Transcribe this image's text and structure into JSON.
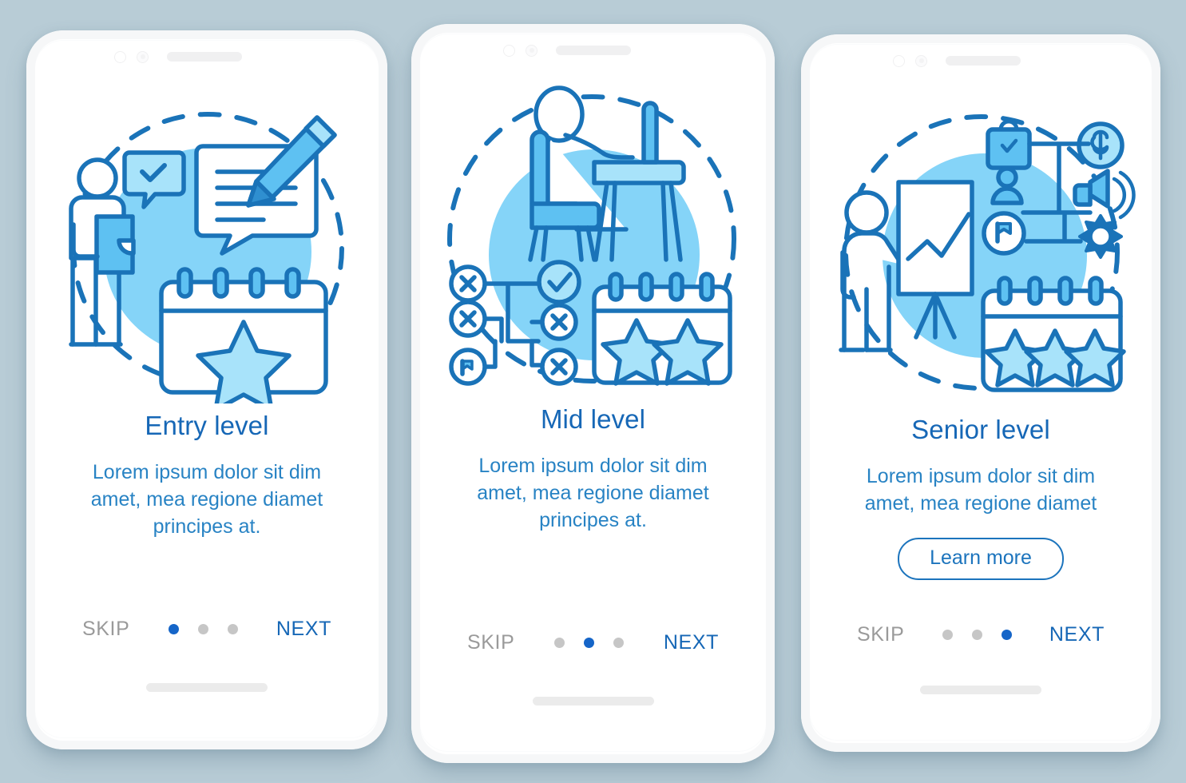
{
  "background_color": "#b8ccd6",
  "theme": {
    "title_color": "#1667b6",
    "body_color": "#2883c4",
    "accent_color": "#1565c8",
    "skip_color": "#9a9a9a",
    "illustration_stroke": "#1a73b8",
    "illustration_fill_light": "#a8e3fa",
    "illustration_fill_mid": "#5ec1f2",
    "illustration_circle": "#85d4f8"
  },
  "screens": [
    {
      "id": "entry-level",
      "title": "Entry level",
      "description": "Lorem ipsum dolor sit dim amet, mea regione diamet principes at.",
      "has_cta": false,
      "cta_label": "",
      "skip_label": "SKIP",
      "next_label": "NEXT",
      "dots": 3,
      "active_dot": 0,
      "illustration_name": "entry-level-illustration",
      "illustration_items": [
        "person-with-clipboard",
        "check-speech-bubble",
        "text-speech-bubble",
        "pencil",
        "calendar-one-star",
        "dashed-circle"
      ]
    },
    {
      "id": "mid-level",
      "title": "Mid level",
      "description": "Lorem ipsum dolor sit dim amet, mea regione diamet principes at.",
      "has_cta": false,
      "cta_label": "",
      "skip_label": "SKIP",
      "next_label": "NEXT",
      "dots": 3,
      "active_dot": 1,
      "illustration_name": "mid-level-illustration",
      "illustration_items": [
        "person-at-desk",
        "chair",
        "desk",
        "checkmark-node",
        "cross-nodes",
        "flag-node",
        "calendar-two-stars",
        "dashed-circle"
      ]
    },
    {
      "id": "senior-level",
      "title": "Senior level",
      "description": "Lorem ipsum dolor sit dim amet, mea regione diamet",
      "has_cta": true,
      "cta_label": "Learn more",
      "skip_label": "SKIP",
      "next_label": "NEXT",
      "dots": 3,
      "active_dot": 2,
      "illustration_name": "senior-level-illustration",
      "illustration_items": [
        "person-presenting",
        "flipchart-with-chart",
        "shopping-bag-check",
        "user-node",
        "dollar-coin",
        "megaphone",
        "flag-node",
        "gear",
        "calendar-three-stars",
        "dashed-circle"
      ]
    }
  ],
  "hardware": {
    "camera_icon": "camera-icon",
    "sensor_icon": "sensor-icon",
    "speaker_icon": "speaker-grille-icon",
    "home_indicator": "home-indicator"
  }
}
